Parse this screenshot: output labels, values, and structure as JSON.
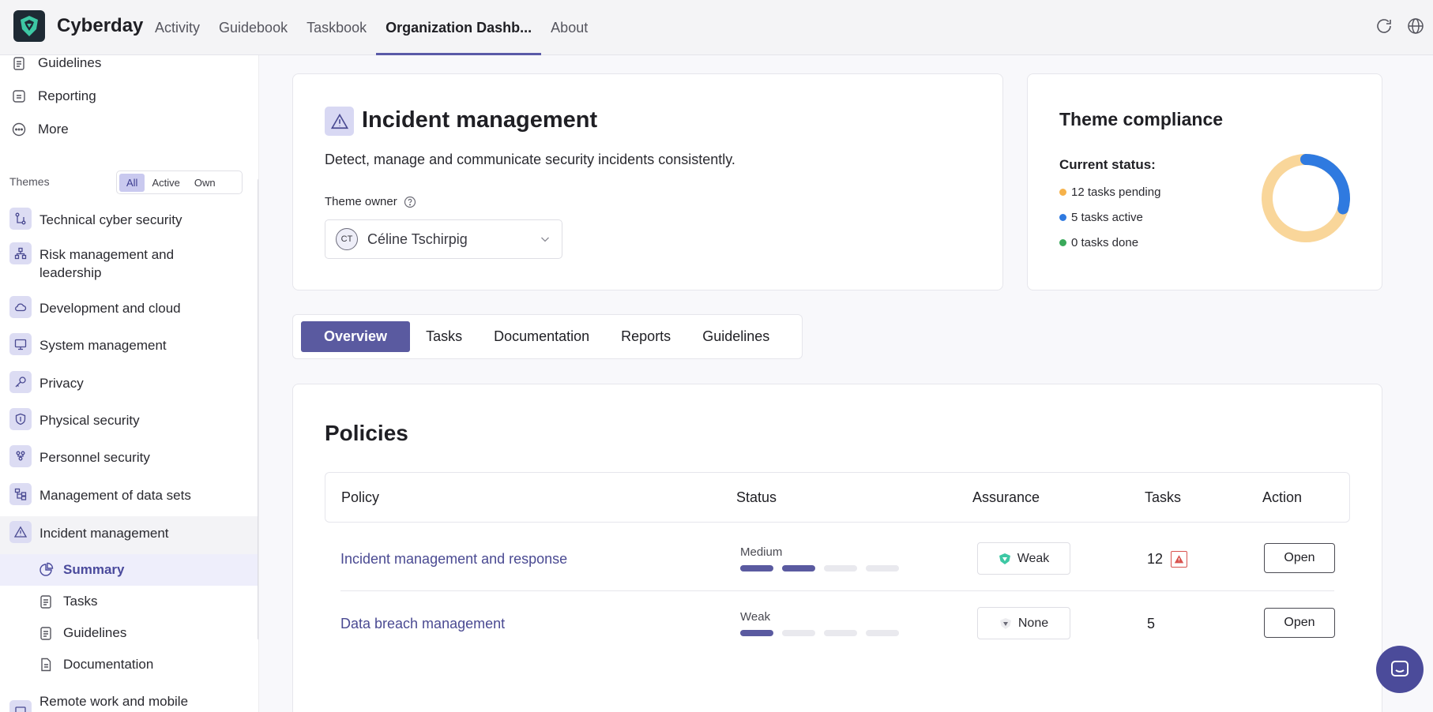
{
  "app": {
    "brand": "Cyberday"
  },
  "nav": [
    {
      "label": "Activity",
      "active": false
    },
    {
      "label": "Guidebook",
      "active": false
    },
    {
      "label": "Taskbook",
      "active": false
    },
    {
      "label": "Organization Dashb...",
      "active": true
    },
    {
      "label": "About",
      "active": false
    }
  ],
  "sidebar": {
    "links": [
      {
        "label": "Guidelines",
        "icon": "clipboard-icon"
      },
      {
        "label": "Reporting",
        "icon": "report-icon"
      },
      {
        "label": "More",
        "icon": "more-icon"
      }
    ],
    "themes_label": "Themes",
    "filter": [
      "All",
      "Active",
      "Own"
    ],
    "themes": [
      "Technical cyber security",
      "Risk management and leadership",
      "Development and cloud",
      "System management",
      "Privacy",
      "Physical security",
      "Personnel security",
      "Management of data sets",
      "Incident management"
    ],
    "subitems": [
      "Summary",
      "Tasks",
      "Guidelines",
      "Documentation"
    ],
    "next_theme": "Remote work and mobile devices"
  },
  "theme_card": {
    "title": "Incident management",
    "description": "Detect, manage and communicate security incidents consistently.",
    "owner_label": "Theme owner",
    "owner_initials": "CT",
    "owner_name": "Céline Tschirpig"
  },
  "compliance": {
    "title": "Theme compliance",
    "status_label": "Current status:",
    "legend": [
      {
        "text": "12 tasks pending",
        "color": "#f6b24a",
        "value": 12
      },
      {
        "text": "5 tasks active",
        "color": "#2f7ae0",
        "value": 5
      },
      {
        "text": "0 tasks done",
        "color": "#3aa95a",
        "value": 0
      }
    ],
    "donut_colors": {
      "pending": "#f9d69a",
      "active": "#2f7ae0"
    }
  },
  "tabs": [
    "Overview",
    "Tasks",
    "Documentation",
    "Reports",
    "Guidelines"
  ],
  "policies": {
    "title": "Policies",
    "headers": {
      "policy": "Policy",
      "status": "Status",
      "assurance": "Assurance",
      "tasks": "Tasks",
      "action": "Action"
    },
    "rows": [
      {
        "name": "Incident management and response",
        "status": "Medium",
        "level": 2,
        "assurance": "Weak",
        "tasks": "12",
        "action": "Open"
      },
      {
        "name": "Data breach management",
        "status": "Weak",
        "level": 1,
        "assurance": "None",
        "tasks": "5",
        "action": "Open"
      }
    ]
  }
}
